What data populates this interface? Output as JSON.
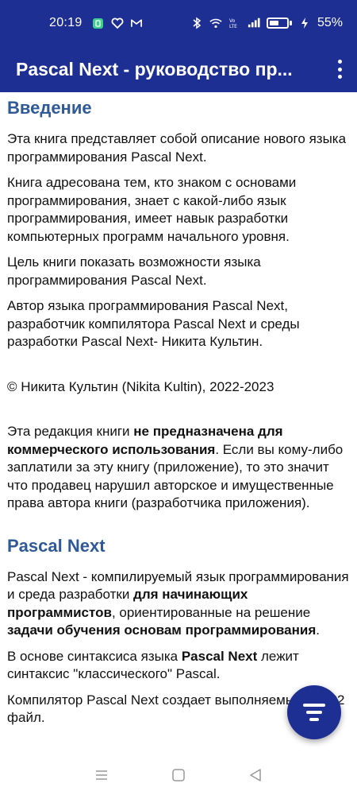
{
  "status_bar": {
    "time": "20:19",
    "battery_text": "55%",
    "battery_level": 0.55,
    "icons": [
      "app-notification-icon",
      "heart-icon",
      "mail-icon",
      "bluetooth-icon",
      "wifi-icon",
      "volte-icon",
      "signal-icon",
      "battery-icon",
      "charging-icon"
    ]
  },
  "app_bar": {
    "title": "Pascal Next - руководство пр...",
    "menu_icon": "overflow-menu-icon"
  },
  "content": {
    "section1": {
      "title": "Введение",
      "p1": "Эта книга представляет собой описание нового языка программирования Pascal Next.",
      "p2": "Книга адресована тем, кто знаком с основами программирования, знает с какой-либо язык программирования, имеет навык разработки компьютерных программ начального уровня.",
      "p3": "Цель книги показать возможности языка программирования Pascal Next.",
      "p4": "Автор языка программирования Pascal Next, разработчик компилятора Pascal Next и среды разработки Pascal Next- Никита Культин.",
      "copyright": "© Никита Культин (Nikita Kultin), 2022-2023",
      "notice_before": "Эта редакция книги ",
      "notice_bold": "не предназначена для коммерческого использования",
      "notice_after": ". Если вы кому-либо заплатили за эту книгу (приложение), то это значит что продавец нарушил авторское и имущественные права автора книги (разработчика приложения)."
    },
    "section2": {
      "title": "Pascal Next",
      "p1_a": "Pascal Next - компилируемый язык программирования и среда разработки ",
      "p1_b": "для начинающих программистов",
      "p1_c": ", ориентированные на решение ",
      "p1_d": "задачи обучения основам программирования",
      "p1_e": ".",
      "p2_a": "В основе синтаксиса языка ",
      "p2_b": "Pascal Next",
      "p2_c": " лежит синтаксис \"классического\" Pascal.",
      "p3": "Компилятор Pascal Next создает выполняемый Win32 файл."
    }
  },
  "fab": {
    "icon": "sort-filter-icon"
  },
  "nav_bar": {
    "icons": [
      "recent-apps-icon",
      "home-icon",
      "back-icon"
    ]
  },
  "colors": {
    "primary": "#1e2f94",
    "heading": "#2f5a97"
  }
}
